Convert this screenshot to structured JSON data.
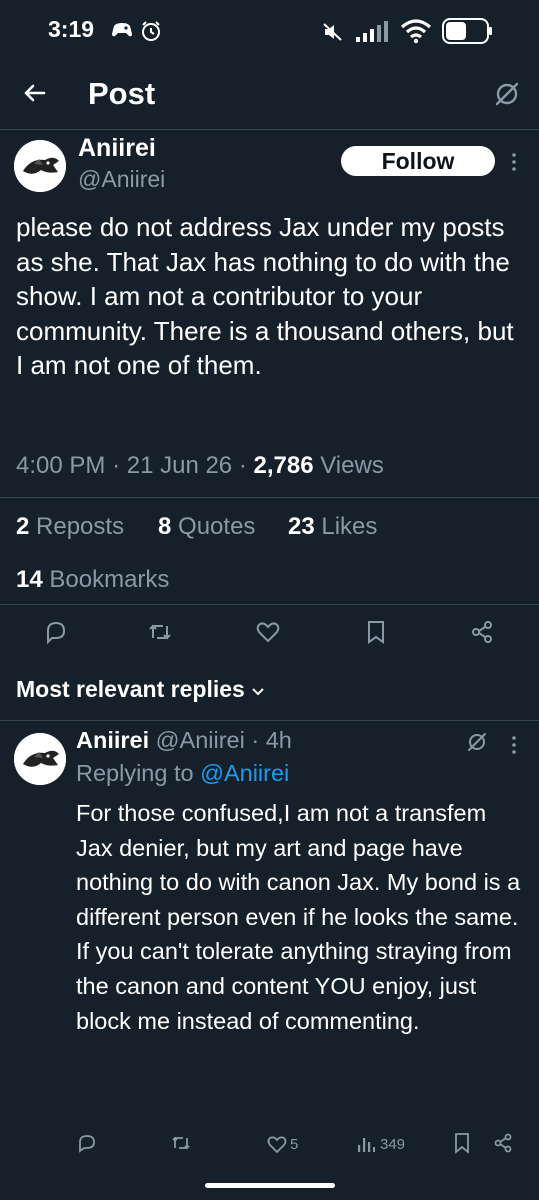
{
  "status_bar": {
    "time": "3:19"
  },
  "header": {
    "title": "Post"
  },
  "post": {
    "author_name": "Aniirei",
    "author_handle": "@Aniirei",
    "follow_label": "Follow",
    "text": "please do not address Jax under my posts as she. That Jax has nothing to do with the show. I am not a contributor to your community. There is a thousand others, but I am not one of them.",
    "time": "4:00 PM",
    "sep": "·",
    "date": "21 Jun 26",
    "views_count": "2,786",
    "views_label": "Views",
    "reposts_count": "2",
    "reposts_label": "Reposts",
    "quotes_count": "8",
    "quotes_label": "Quotes",
    "likes_count": "23",
    "likes_label": "Likes",
    "bookmarks_count": "14",
    "bookmarks_label": "Bookmarks"
  },
  "replies_section": {
    "title": "Most relevant replies"
  },
  "reply": {
    "author_name": "Aniirei",
    "author_handle": "@Aniirei",
    "sep": "·",
    "age": "4h",
    "replying_to_label": "Replying to",
    "replying_to_handle": "@Aniirei",
    "text": "For those confused,I am not a transfem Jax denier, but my art and page have nothing to do with canon Jax. My bond is a different person even if he looks the same. If you can't tolerate anything straying from the canon and content YOU enjoy,  just block me instead of commenting.",
    "likes": "5",
    "views": "349"
  },
  "colors": {
    "background": "#15202b",
    "muted": "#8b98a5",
    "accent": "#1d9bf0",
    "divider": "#38444d"
  }
}
